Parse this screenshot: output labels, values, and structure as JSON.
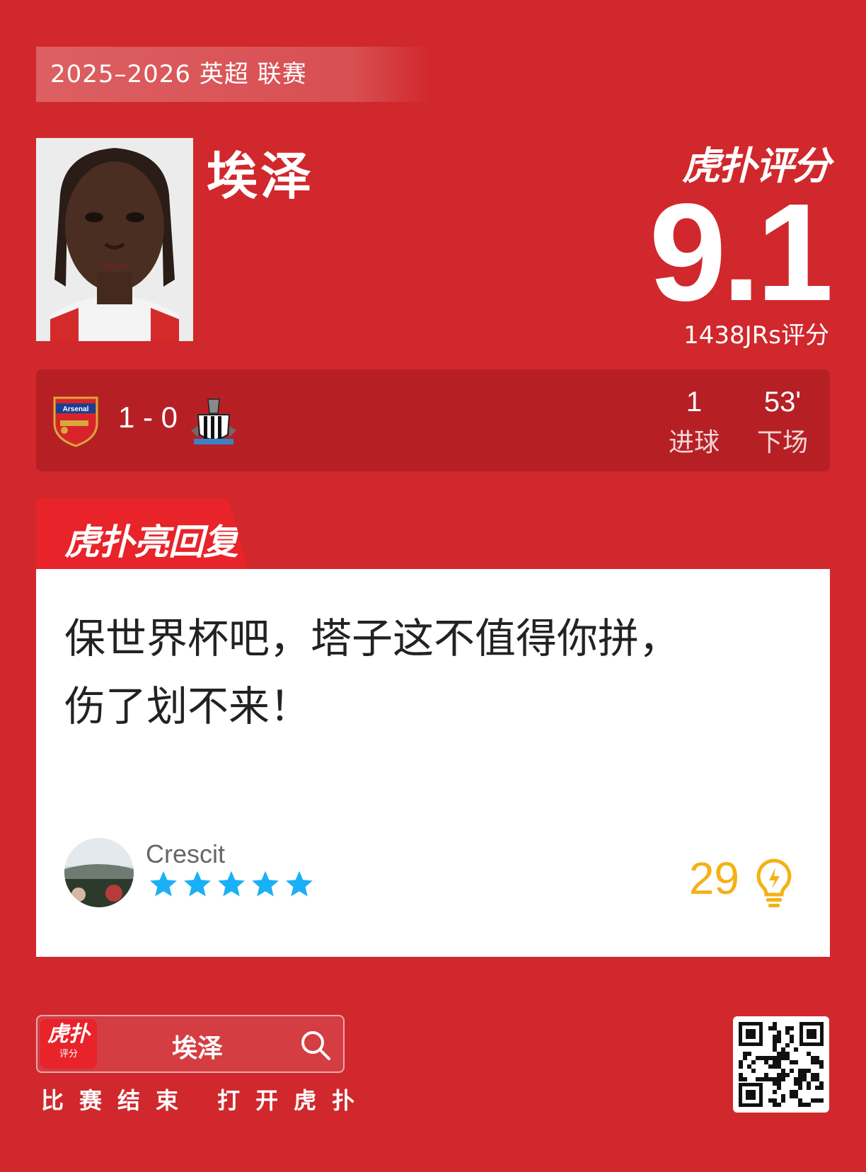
{
  "season_label": "2025–2026 英超 联赛",
  "player": {
    "name": "埃泽"
  },
  "brand": {
    "title": "虎扑评分"
  },
  "rating": {
    "score": "9.1",
    "count": "1438JRs评分"
  },
  "match": {
    "home_club": "Arsenal",
    "away_club": "Newcastle United",
    "score": "1 - 0",
    "stats": [
      {
        "value": "1",
        "label": "进球"
      },
      {
        "value": "53'",
        "label": "下场"
      }
    ]
  },
  "reply": {
    "tab_label": "虎扑亮回复",
    "comment_line1": "保世界杯吧，塔子这不值得你拼，",
    "comment_line2": "伤了划不来！",
    "username": "Crescit",
    "star_rating": 5,
    "likes": "29"
  },
  "footer": {
    "app_logo_title": "虎扑",
    "app_logo_sub": "评分",
    "search_text": "埃泽",
    "caption": "比赛结束 打开虎扑"
  },
  "colors": {
    "background": "#d0282c",
    "accent": "#e8232a",
    "star": "#1ab0f5",
    "likes": "#f4b117"
  }
}
